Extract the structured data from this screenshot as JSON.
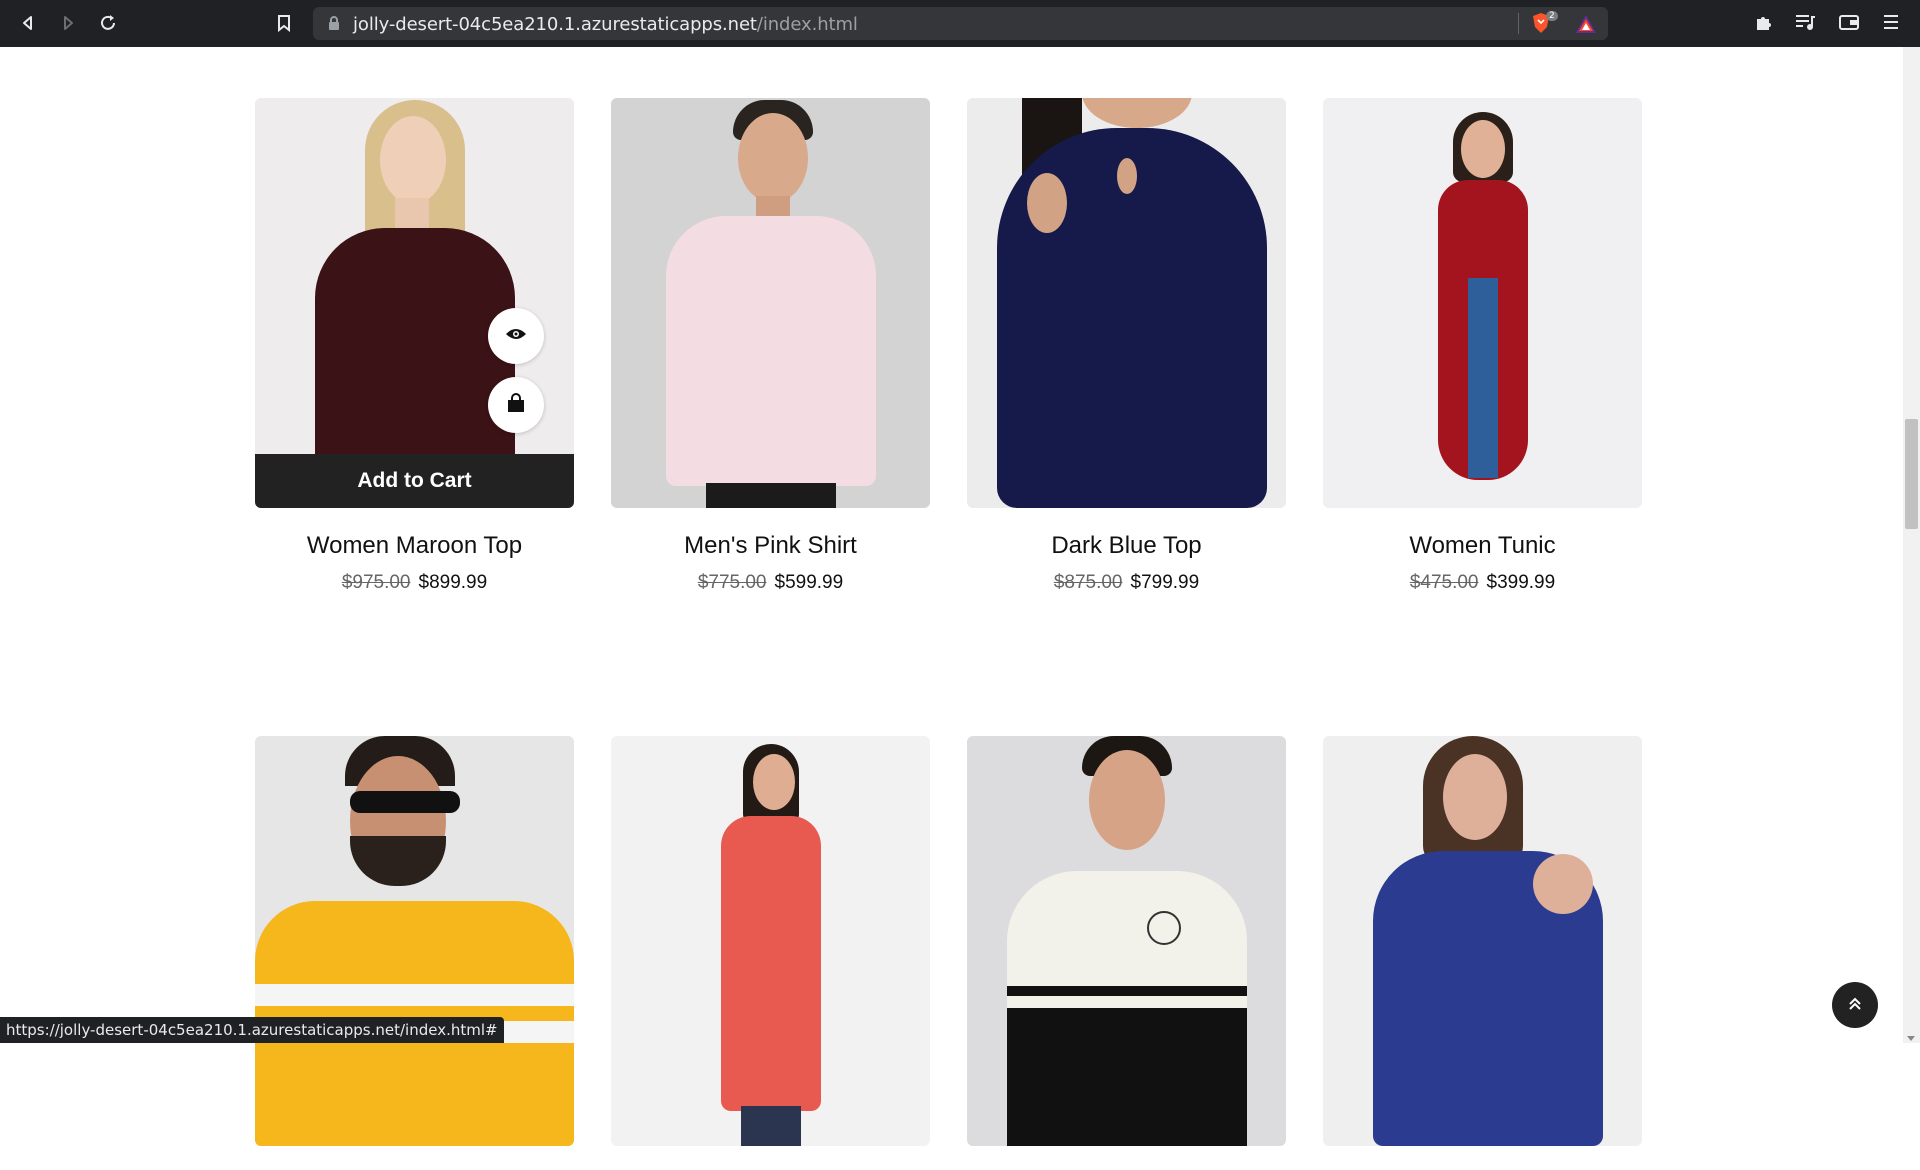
{
  "browser": {
    "url_host": "jolly-desert-04c5ea210.1.azurestaticapps.net",
    "url_path": "/index.html",
    "shield_count": "2",
    "status_url": "https://jolly-desert-04c5ea210.1.azurestaticapps.net/index.html#"
  },
  "products": [
    {
      "name": "Women Maroon Top",
      "old_price": "$975.00",
      "price": "$899.99",
      "hovered": true,
      "add_to_cart": "Add to Cart"
    },
    {
      "name": "Men's Pink Shirt",
      "old_price": "$775.00",
      "price": "$599.99"
    },
    {
      "name": "Dark Blue Top",
      "old_price": "$875.00",
      "price": "$799.99"
    },
    {
      "name": "Women Tunic",
      "old_price": "$475.00",
      "price": "$399.99"
    },
    {
      "name": "",
      "old_price": "",
      "price": ""
    },
    {
      "name": "",
      "old_price": "",
      "price": ""
    },
    {
      "name": "",
      "old_price": "",
      "price": ""
    },
    {
      "name": "",
      "old_price": "",
      "price": ""
    }
  ],
  "colors": {
    "chrome_bg": "#202124",
    "url_bg": "#35363a",
    "overlay": "#222222",
    "text": "#111111"
  },
  "icons": {
    "quick_view": "eye-icon",
    "cart": "shopping-bag-icon",
    "scroll_top": "double-chevron-up-icon"
  }
}
